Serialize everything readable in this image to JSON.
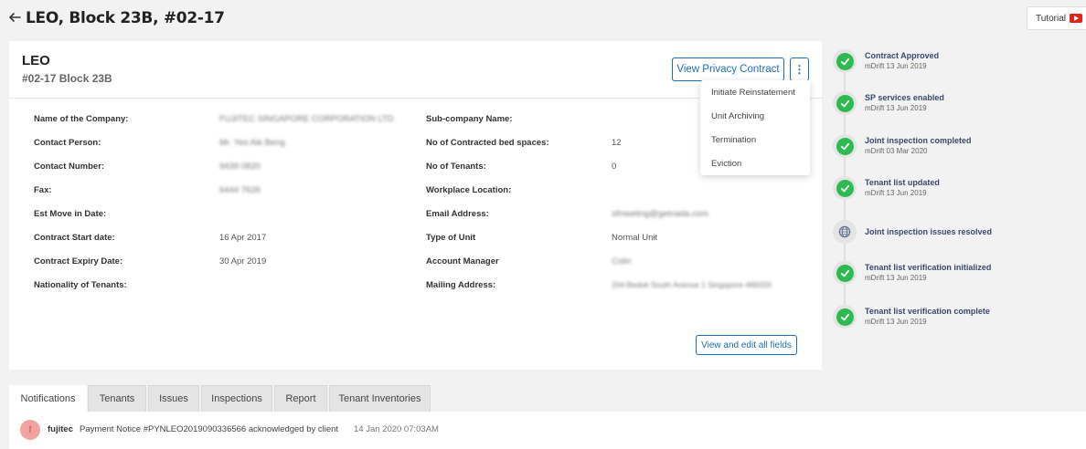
{
  "header": {
    "title": "LEO, Block 23B, #02-17",
    "tutorial_label": "Tutorial"
  },
  "unit": {
    "name": "LEO",
    "subtitle": "#02-17 Block 23B",
    "view_privacy_label": "View Privacy Contract",
    "more_label": "⋮"
  },
  "actions_menu": {
    "items": [
      "Initiate Reinstatement",
      "Unit Archiving",
      "Termination",
      "Eviction"
    ]
  },
  "details": {
    "left": [
      {
        "label": "Name of the Company:",
        "value": "FUJITEC SINGAPORE CORPORATION LTD"
      },
      {
        "label": "Contact Person:",
        "value": "Mr. Yeo Aik Beng"
      },
      {
        "label": "Contact Number:",
        "value": "9439 0820"
      },
      {
        "label": "Fax:",
        "value": "6444 7626"
      },
      {
        "label": "Est Move in Date:",
        "value": ""
      },
      {
        "label": "Contract Start date:",
        "value": "16 Apr 2017"
      },
      {
        "label": "Contract Expiry Date:",
        "value": "30 Apr 2019"
      },
      {
        "label": "Nationality of Tenants:",
        "value": ""
      }
    ],
    "right": [
      {
        "label": "Sub-company Name:",
        "value": ""
      },
      {
        "label": "No of Contracted bed spaces:",
        "value": "12"
      },
      {
        "label": "No of Tenants:",
        "value": "0"
      },
      {
        "label": "Workplace Location:",
        "value": ""
      },
      {
        "label": "Email Address:",
        "value": "sfmeeting@getnada.com"
      },
      {
        "label": "Type of Unit",
        "value": "Normal Unit"
      },
      {
        "label": "Account Manager",
        "value": "Colin"
      },
      {
        "label": "Mailing Address:",
        "value": "204 Bedok South Avenue 1 Singapore 469333"
      }
    ],
    "view_edit_label": "View and edit all fields"
  },
  "timeline": [
    {
      "title": "Contract Approved",
      "sub": "mDrift 13 Jun 2019",
      "status": "done"
    },
    {
      "title": "SP services enabled",
      "sub": "mDrift 13 Jun 2019",
      "status": "done"
    },
    {
      "title": "Joint inspection completed",
      "sub": "mDrift 03 Mar 2020",
      "status": "done"
    },
    {
      "title": "Tenant list updated",
      "sub": "mDrift 13 Jun 2019",
      "status": "done"
    },
    {
      "title": "Joint inspection issues resolved",
      "sub": "",
      "status": "pending"
    },
    {
      "title": "Tenant list verification initialized",
      "sub": "mDrift 13 Jun 2019",
      "status": "done"
    },
    {
      "title": "Tenant list verification complete",
      "sub": "mDrift 13 Jun 2019",
      "status": "done"
    }
  ],
  "tabs": [
    "Notifications",
    "Tenants",
    "Issues",
    "Inspections",
    "Report",
    "Tenant Inventories"
  ],
  "notification": {
    "avatar": "f",
    "user": "fujitec",
    "message": "Payment Notice #PYNLEO2019090336566 acknowledged by client",
    "time": "14 Jan 2020 07:03AM"
  },
  "colors": {
    "accent": "#1f6fb5",
    "success": "#2dbb4f",
    "background": "#f2f2f2"
  }
}
